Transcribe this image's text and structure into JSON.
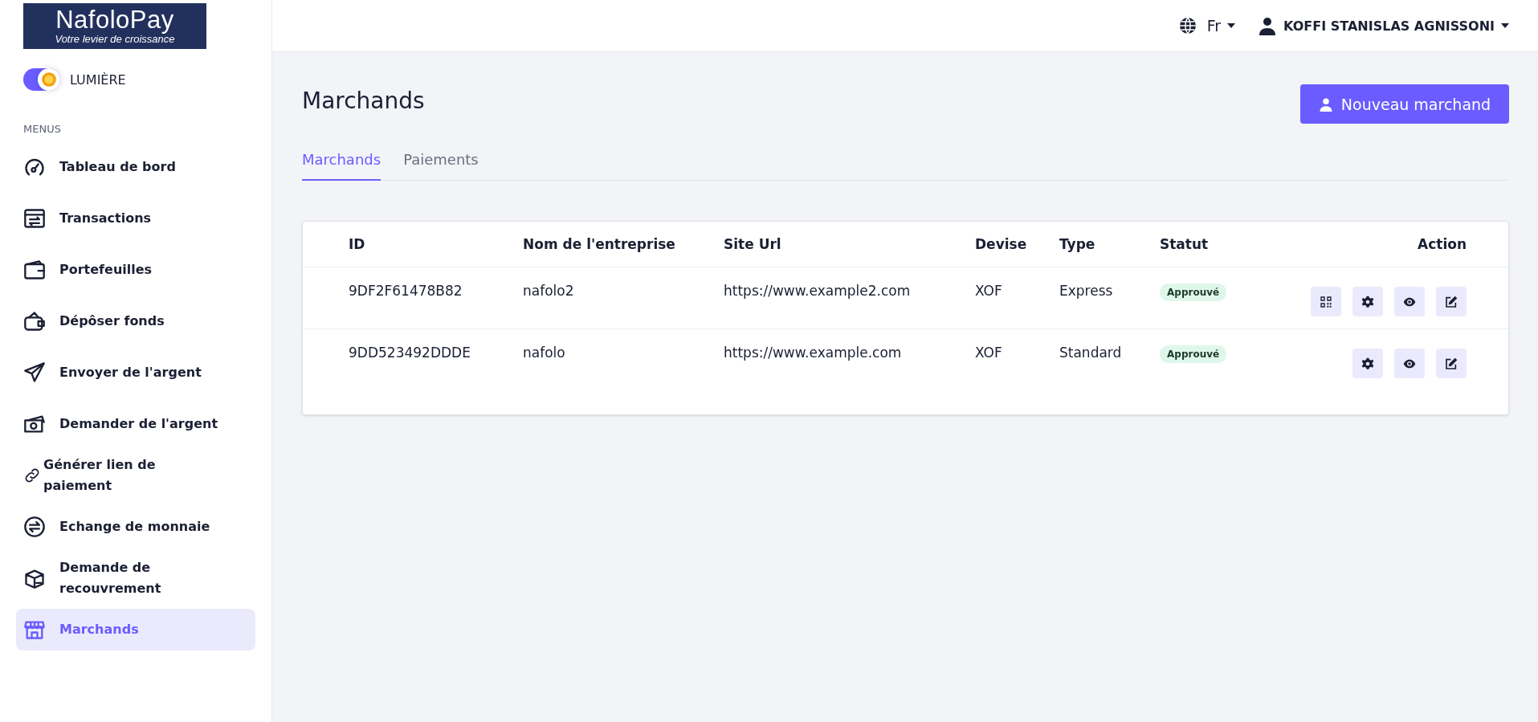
{
  "logo": {
    "name": "NafoloPay",
    "tagline": "Votre levier de croissance"
  },
  "theme_toggle": {
    "label": "LUMIÈRE",
    "on": true
  },
  "sidebar": {
    "section": "MENUS",
    "items": [
      {
        "label": "Tableau de bord",
        "selected": false
      },
      {
        "label": "Transactions",
        "selected": false
      },
      {
        "label": "Portefeuilles",
        "selected": false
      },
      {
        "label": "Dépôser fonds",
        "selected": false
      },
      {
        "label": "Envoyer de l'argent",
        "selected": false
      },
      {
        "label": "Demander de l'argent",
        "selected": false
      },
      {
        "label": "Générer lien de paiement",
        "selected": false
      },
      {
        "label": "Echange de monnaie",
        "selected": false
      },
      {
        "label": "Demande de recouvrement",
        "selected": false
      },
      {
        "label": "Marchands",
        "selected": true
      }
    ]
  },
  "header": {
    "language": "Fr",
    "user": "KOFFI STANISLAS AGNISSONI"
  },
  "page": {
    "title": "Marchands",
    "new_button": "Nouveau marchand"
  },
  "tabs": [
    {
      "label": "Marchands",
      "selected": true
    },
    {
      "label": "Paiements",
      "selected": false
    }
  ],
  "table": {
    "columns": [
      "ID",
      "Nom de l'entreprise",
      "Site Url",
      "Devise",
      "Type",
      "Statut",
      "Action"
    ],
    "rows": [
      {
        "id": "9DF2F61478B82",
        "name": "nafolo2",
        "url": "https://www.example2.com",
        "currency": "XOF",
        "type": "Express",
        "status": "Approuvé",
        "actions": [
          {
            "kind": "qr"
          },
          {
            "kind": "settings"
          },
          {
            "kind": "view"
          },
          {
            "kind": "edit"
          }
        ]
      },
      {
        "id": "9DD523492DDDE",
        "name": "nafolo",
        "url": "https://www.example.com",
        "currency": "XOF",
        "type": "Standard",
        "status": "Approuvé",
        "actions": [
          {
            "kind": "settings"
          },
          {
            "kind": "view"
          },
          {
            "kind": "edit"
          }
        ]
      }
    ]
  }
}
